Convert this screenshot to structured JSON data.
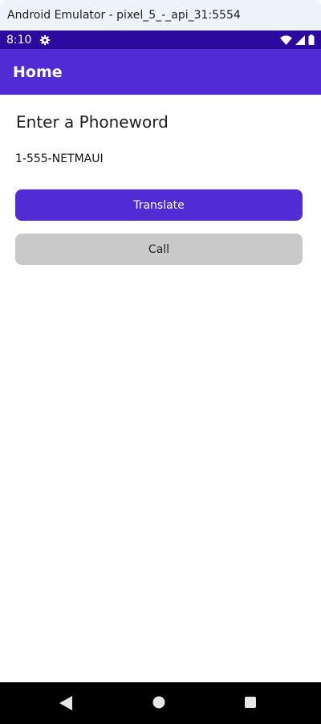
{
  "window": {
    "title": "Android Emulator - pixel_5_-_api_31:5554"
  },
  "status_bar": {
    "time": "8:10",
    "icons": [
      "gear-icon",
      "wifi-icon",
      "signal-icon",
      "battery-icon"
    ]
  },
  "app_bar": {
    "title": "Home"
  },
  "main": {
    "heading": "Enter a Phoneword",
    "phone_entry": {
      "value": "1-555-NETMAUI"
    },
    "translate_label": "Translate",
    "call_label": "Call"
  },
  "nav_bar": {
    "icons": [
      "back-icon",
      "home-icon",
      "recents-icon"
    ]
  },
  "colors": {
    "primary": "#512bd4",
    "status_bar": "#2b0a9e",
    "call_button": "#c9c9c9",
    "nav_bar": "#000000"
  }
}
